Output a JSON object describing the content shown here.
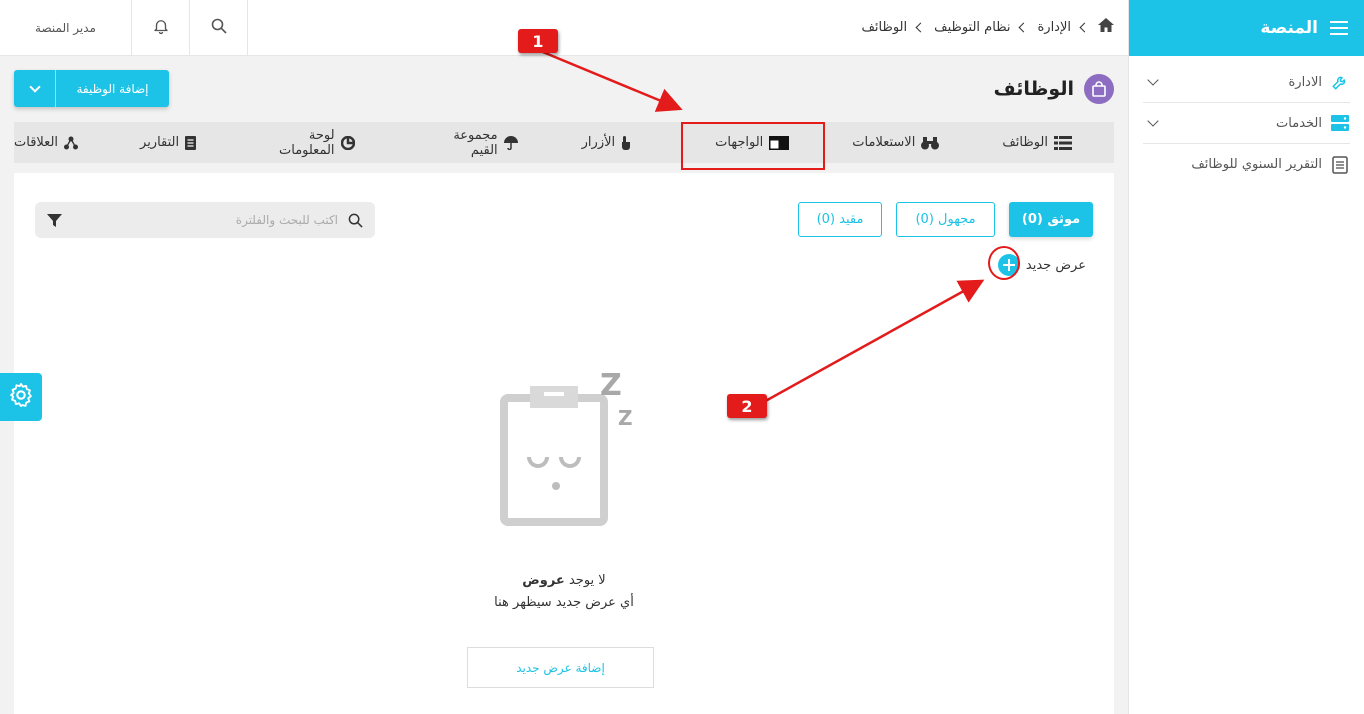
{
  "sidebar": {
    "title": "المنصة",
    "items": [
      {
        "label": "الادارة",
        "icon": "wrench-icon",
        "expandable": true
      },
      {
        "label": "الخدمات",
        "icon": "server-icon",
        "expandable": true
      },
      {
        "label": "التقرير السنوي للوظائف",
        "icon": "document-icon",
        "expandable": false
      }
    ]
  },
  "topbar": {
    "user": "مدير المنصة",
    "breadcrumb": [
      "الإدارة",
      "نظام التوظيف",
      "الوظائف"
    ]
  },
  "page": {
    "title": "الوظائف",
    "add_button": "إضافة الوظيفة"
  },
  "tabs": [
    {
      "label": "الوظائف",
      "icon": "list-icon"
    },
    {
      "label": "الاستعلامات",
      "icon": "binoculars-icon"
    },
    {
      "label": "الواجهات",
      "icon": "layout-icon"
    },
    {
      "label": "الأزرار",
      "icon": "pointer-icon"
    },
    {
      "label": "مجموعة القيم",
      "icon": "umbrella-icon"
    },
    {
      "label": "لوحة المعلومات",
      "icon": "pie-chart-icon"
    },
    {
      "label": "التقارير",
      "icon": "report-icon"
    },
    {
      "label": "العلاقات",
      "icon": "relations-icon"
    }
  ],
  "filters": [
    {
      "label": "موثق (0)",
      "active": true
    },
    {
      "label": "مجهول (0)",
      "active": false
    },
    {
      "label": "مقيد (0)",
      "active": false
    }
  ],
  "search": {
    "placeholder": "اكتب للبحث والفلترة"
  },
  "new_offer_label": "عرض جديد",
  "empty_state": {
    "prefix": "لا يوجد",
    "bold": "عروض",
    "subtitle": "أي عرض جديد سيظهر هنا",
    "button": "إضافة عرض جديد"
  },
  "annotations": {
    "callout_1": "1",
    "callout_2": "2"
  },
  "colors": {
    "accent": "#1cc3e6",
    "annotation_red": "#e31b1b",
    "title_icon": "#8c6dc1"
  }
}
